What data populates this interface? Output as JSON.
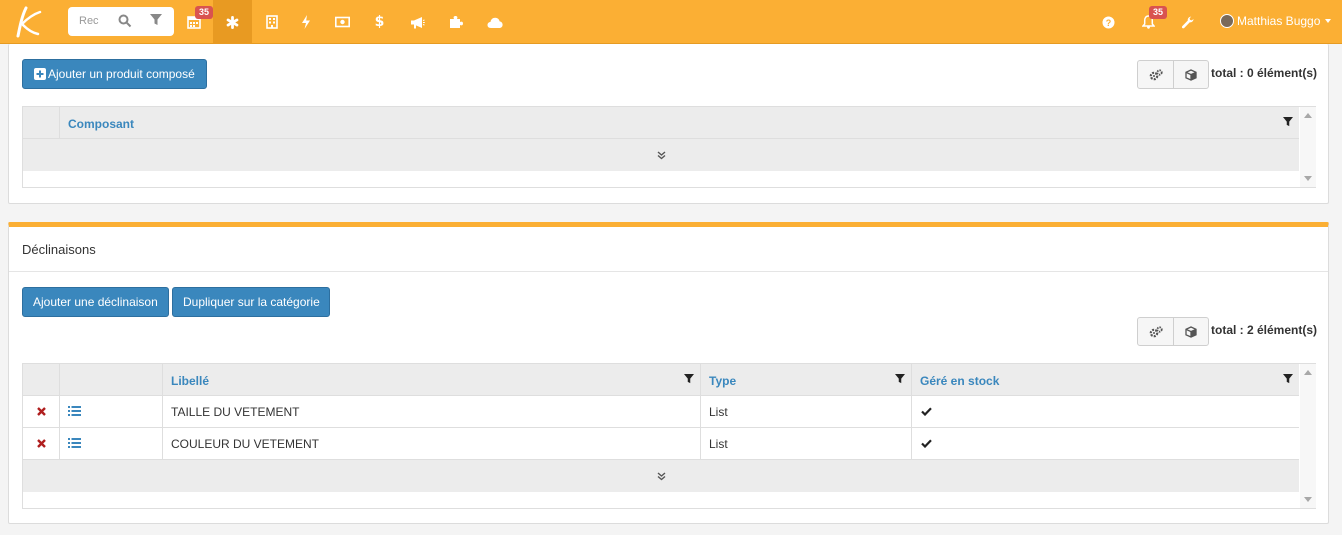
{
  "navbar": {
    "search_placeholder": "Rechercher",
    "search_display": "Rec",
    "calendar_badge": "35",
    "notifications_badge": "35",
    "user_name": "Matthias Buggo",
    "icons": [
      "calendar-icon",
      "asterisk-icon",
      "building-icon",
      "bolt-icon",
      "money-icon",
      "dollar-icon",
      "bullhorn-icon",
      "puzzle-icon",
      "cloud-icon",
      "help-icon",
      "bell-icon",
      "wrench-icon"
    ],
    "colors": {
      "bar": "#fbaf34",
      "active": "#e89a22",
      "badge": "#d9534f"
    }
  },
  "composite": {
    "add_button": "Ajouter un produit composé",
    "total": "total : 0 élément(s)",
    "column": "Composant"
  },
  "declinaisons": {
    "title": "Déclinaisons",
    "add_button": "Ajouter une déclinaison",
    "duplicate_button": "Dupliquer sur la catégorie",
    "total": "total : 2 élément(s)",
    "columns": [
      "Libellé",
      "Type",
      "Géré en stock"
    ],
    "rows": [
      {
        "libelle": "TAILLE DU VETEMENT",
        "type": "List",
        "stock": true
      },
      {
        "libelle": "COULEUR DU VETEMENT",
        "type": "List",
        "stock": true
      }
    ]
  },
  "colors": {
    "primary": "#3a87bd",
    "delete": "#b01e1e"
  }
}
